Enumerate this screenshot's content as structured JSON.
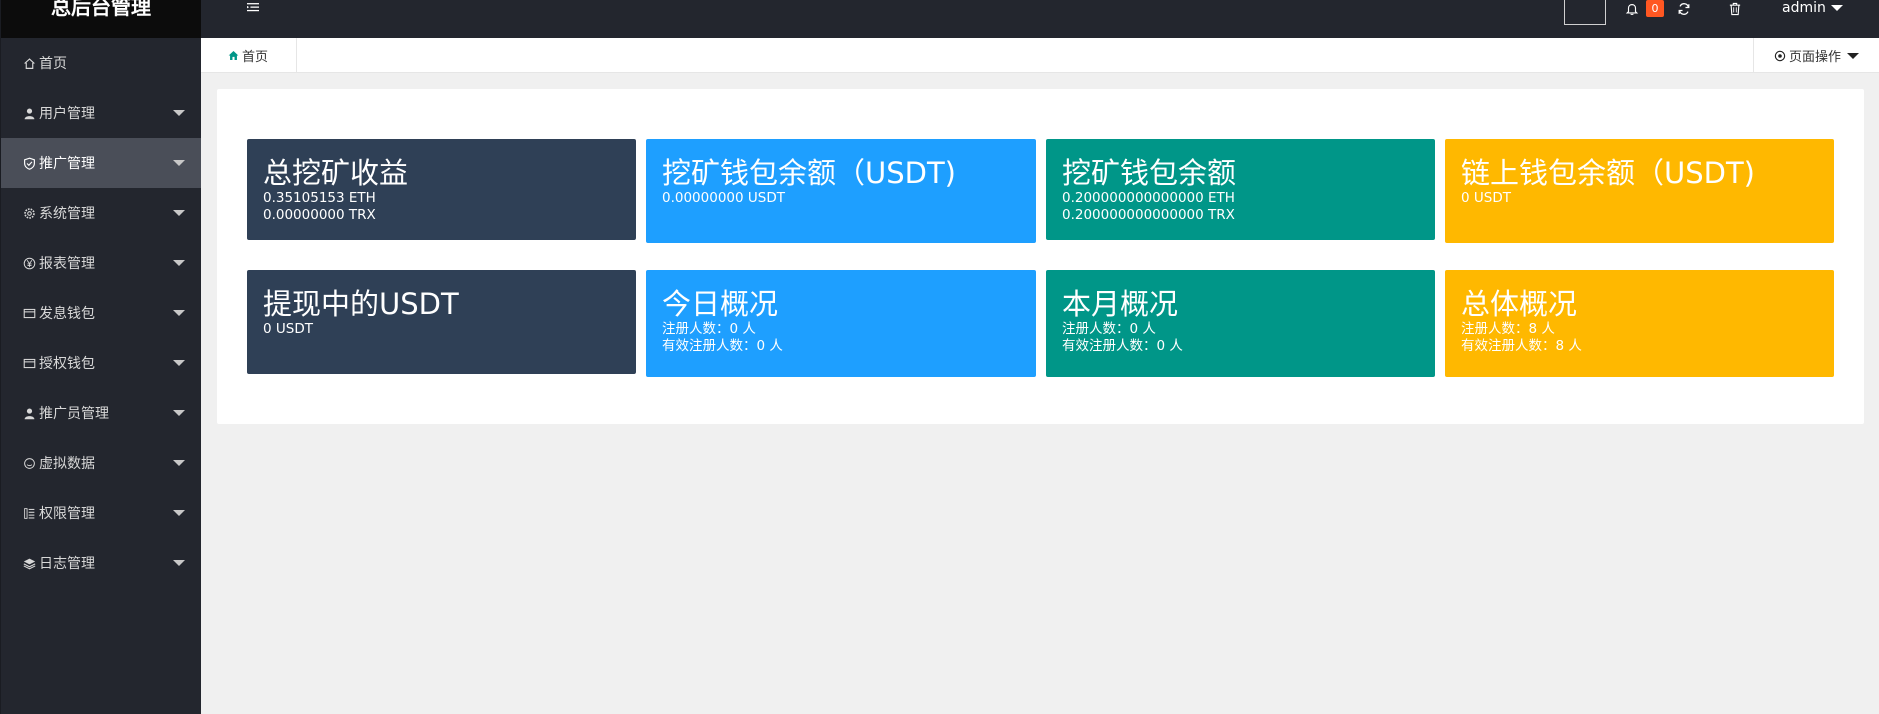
{
  "app_title": "总后台管理",
  "sidebar": {
    "items": [
      {
        "label": "首页",
        "icon": "home-icon",
        "has_caret": false
      },
      {
        "label": "用户管理",
        "icon": "user-icon",
        "has_caret": true
      },
      {
        "label": "推广管理",
        "icon": "shield-icon",
        "has_caret": true,
        "active": true
      },
      {
        "label": "系统管理",
        "icon": "gear-icon",
        "has_caret": true
      },
      {
        "label": "报表管理",
        "icon": "yen-icon",
        "has_caret": true
      },
      {
        "label": "发息钱包",
        "icon": "wallet-icon",
        "has_caret": true
      },
      {
        "label": "授权钱包",
        "icon": "wallet-icon",
        "has_caret": true
      },
      {
        "label": "推广员管理",
        "icon": "user-icon",
        "has_caret": true
      },
      {
        "label": "虚拟数据",
        "icon": "smile-icon",
        "has_caret": true
      },
      {
        "label": "权限管理",
        "icon": "key-list-icon",
        "has_caret": true
      },
      {
        "label": "日志管理",
        "icon": "layers-icon",
        "has_caret": true
      }
    ]
  },
  "header": {
    "notification_count": "0",
    "username": "admin"
  },
  "tabs": {
    "home_label": "首页",
    "page_ops_label": "页面操作"
  },
  "cards": [
    {
      "title": "总挖矿收益",
      "lines": [
        "0.35105153 ETH",
        "0.00000000 TRX"
      ],
      "color": "#2f4056"
    },
    {
      "title": "挖矿钱包余额（USDT)",
      "lines": [
        "0.00000000 USDT"
      ],
      "color": "#1e9fff"
    },
    {
      "title": "挖矿钱包余额",
      "lines": [
        "0.200000000000000 ETH",
        "0.200000000000000 TRX"
      ],
      "color": "#009688"
    },
    {
      "title": "链上钱包余额（USDT)",
      "lines": [
        "0 USDT"
      ],
      "color": "#ffb800"
    },
    {
      "title": "提现中的USDT",
      "lines": [
        "0 USDT"
      ],
      "color": "#2f4056"
    },
    {
      "title": "今日概况",
      "lines": [
        "注册人数：0 人",
        "有效注册人数：0 人"
      ],
      "color": "#1e9fff"
    },
    {
      "title": "本月概况",
      "lines": [
        "注册人数：0 人",
        "有效注册人数：0 人"
      ],
      "color": "#009688"
    },
    {
      "title": "总体概况",
      "lines": [
        "注册人数：8 人",
        "有效注册人数：8 人"
      ],
      "color": "#ffb800"
    }
  ]
}
